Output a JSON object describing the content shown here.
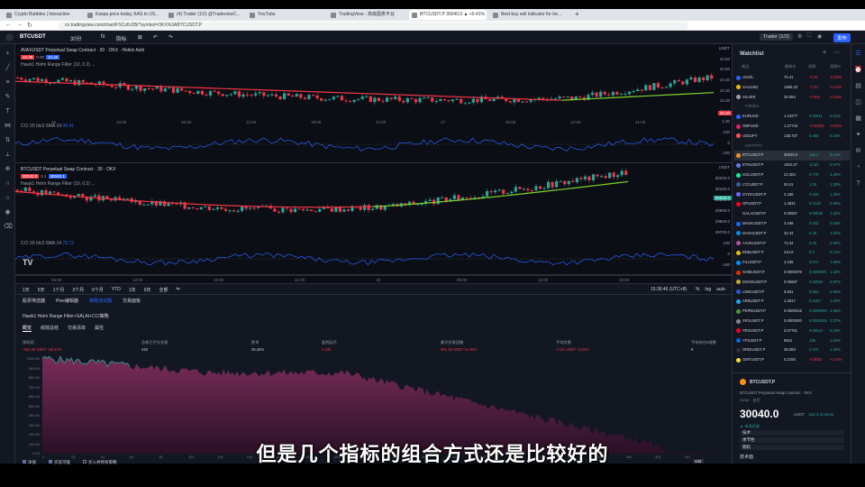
{
  "browser": {
    "tabs": [
      {
        "title": "Crypto Bubbles | Interactive",
        "active": false
      },
      {
        "title": "Kaspa price today, KAS to US...",
        "active": false
      },
      {
        "title": "(4) Trader (1/2) @TradeviewC...",
        "active": false
      },
      {
        "title": "YouTube",
        "active": false
      },
      {
        "title": "TradingView - 高级图表平台",
        "active": false
      },
      {
        "title": "BTCUSDT.P 30040.0 ▲ +0.41%",
        "active": true
      },
      {
        "title": "Best buy sell indicator for tre...",
        "active": false
      }
    ],
    "new_tab": "+",
    "url": "cn.tradingview.com/chart/FSCzfUZB/?symbol=OKX%3ABTCUSDT.P"
  },
  "toolbar": {
    "symbol": "BTCUSDT",
    "interval": "30分",
    "items": [
      "fx",
      "指标",
      "⊞",
      "↶",
      "↷"
    ],
    "right_items": [
      "Trader (1/2)",
      "⚙",
      "⛶",
      "📷"
    ],
    "publish": "发布"
  },
  "pane1": {
    "title": "AVAXUSDT Perpetual Swap Contract · 30 · OKX · Heikin Ashi",
    "bid": "10.39",
    "spread": "0.00",
    "ask": "10.40",
    "indicator": "Hawk1 Helm Range Filter (10, 0.2) ...",
    "rsi_label": "CCI 20 hlc3 SMA 14",
    "rsi_value": "45.41",
    "scale": [
      "USDT",
      "10.60",
      "10.50",
      "10.40",
      "10.30",
      "10.20",
      "10.10",
      "1.00",
      "100",
      "0",
      "-100"
    ],
    "time_labels": [
      "16",
      "10:00",
      "06:00",
      "12:00",
      "18:00",
      "21:00",
      "17",
      "06:00",
      "12:00",
      "21:00"
    ],
    "last_price": "10.40"
  },
  "pane2": {
    "title": "BTCUSDT Perpetual Swap Contract · 30 · OKX",
    "bid": "30040.0",
    "spread": "0.1",
    "ask": "30040.1",
    "indicator": "Hawk1 Helm Range Filter (10, 0.2) ...",
    "rsi_label": "CCI 20 hlc3 SMA 14",
    "rsi_value": "76.73",
    "scale": [
      "USDT",
      "30200.0",
      "30100.0",
      "30000.0",
      "29900.0",
      "29800.0",
      "29700.0",
      "100",
      "0",
      "-100"
    ],
    "time_labels": [
      "06:00",
      "12:00",
      "18:00",
      "21:00",
      "18",
      "06:00",
      "12:00",
      "15:00"
    ],
    "last_price": "30040.0",
    "logo": "TV"
  },
  "ranges": {
    "items": [
      "1天",
      "5天",
      "1个月",
      "3个月",
      "6个月",
      "YTD",
      "1年",
      "5年",
      "全部",
      "⇋"
    ],
    "clock": "15:36:46 (UTC+8)",
    "options": [
      "%",
      "log",
      "auto"
    ]
  },
  "bottom": {
    "tabs": [
      "股票筛选器",
      "Pine编辑器",
      "策略测试器",
      "交易面板"
    ],
    "strategy": "Hawk1 Helm Range Filter+SALAI+CCI策略",
    "subtabs": [
      "概览",
      "绩效总结",
      "交易清单",
      "属性"
    ],
    "stats": [
      {
        "label": "净利润",
        "value": "-981.39 USDT  -98.14%"
      },
      {
        "label": "总和已平仓交易",
        "value": "442"
      },
      {
        "label": "胜率",
        "value": "25.34%"
      },
      {
        "label": "盈利因子",
        "value": "0.432"
      },
      {
        "label": "最大交易回撤",
        "value": "981.39 USDT  11.48%"
      },
      {
        "label": "平均交易",
        "value": "-2.22 USDT  -0.22%"
      },
      {
        "label": "平均持仓K线数",
        "value": "9"
      }
    ],
    "y_labels": [
      "1000.00",
      "900.00",
      "800.00",
      "700.00",
      "600.00",
      "500.00",
      "400.00",
      "300.00",
      "200.00",
      "100.00",
      "0.00"
    ],
    "x_labels": [
      "1",
      "21",
      "41",
      "61",
      "81",
      "101",
      "121",
      "141",
      "161",
      "181",
      "201",
      "221",
      "241",
      "261",
      "281",
      "301",
      "321",
      "341",
      "361",
      "381",
      "401",
      "421",
      "441"
    ],
    "checkboxes": [
      "净值",
      "买卖可能",
      "买入并持有策略"
    ],
    "legend_value": "442"
  },
  "watchlist": {
    "title": "Watchlist",
    "columns": [
      "商品",
      "最新价",
      "涨跌",
      "涨跌%"
    ],
    "items": [
      {
        "sym": "USOIL",
        "last": "75.41",
        "chg": "-0.15",
        "pct": "-0.20%",
        "up": false,
        "color": "#2962ff"
      },
      {
        "sym": "XAUUSD",
        "last": "1965.33",
        "chg": "-2.70",
        "pct": "-0.14%",
        "up": false,
        "color": "#f0b90b"
      },
      {
        "sym": "SILVER",
        "last": "25.084",
        "chg": "-0.064",
        "pct": "-0.25%",
        "up": false,
        "color": "#9e9e9e"
      },
      {
        "sym": "FOREX",
        "section": true
      },
      {
        "sym": "EURUSD",
        "last": "1.10277",
        "chg": "0.00011",
        "pct": "0.01%",
        "up": true,
        "color": "#2962ff"
      },
      {
        "sym": "GBPUSD",
        "last": "1.27743",
        "chg": "-0.00054",
        "pct": "-0.04%",
        "up": false,
        "color": "#e91e63"
      },
      {
        "sym": "USDJPY",
        "last": "138.707",
        "chg": "0.466",
        "pct": "0.34%",
        "up": true,
        "color": "#ff5252"
      },
      {
        "sym": "CRYPTO",
        "section": true
      },
      {
        "sym": "BTCUSDT.P",
        "last": "30040.0",
        "chg": "122.4",
        "pct": "0.41%",
        "up": true,
        "color": "#f7931a",
        "active": true
      },
      {
        "sym": "ETHUSDT.P",
        "last": "1910.27",
        "chg": "12.83",
        "pct": "0.67%",
        "up": true,
        "color": "#627eea"
      },
      {
        "sym": "SOLUSDT.P",
        "last": "22.304",
        "chg": "0.779",
        "pct": "3.49%",
        "up": true,
        "color": "#14f195"
      },
      {
        "sym": "LTCUSDT.P",
        "last": "93.41",
        "chg": "1.29",
        "pct": "1.38%",
        "up": true,
        "color": "#345d9d"
      },
      {
        "sym": "DYDXUSDT.P",
        "last": "2.166",
        "chg": "0.030",
        "pct": "1.39%",
        "up": true,
        "color": "#6966ff"
      },
      {
        "sym": "OPUSDT.P",
        "last": "1.4931",
        "chg": "0.0148",
        "pct": "0.99%",
        "up": true,
        "color": "#ff0420"
      },
      {
        "sym": "GALAUSDT.P",
        "last": "0.02657",
        "chg": "0.00032",
        "pct": "1.22%",
        "up": true,
        "color": "#111111"
      },
      {
        "sym": "MASKUSDT.P",
        "last": "3.446",
        "chg": "0.032",
        "pct": "0.93%",
        "up": true,
        "color": "#1c68f3"
      },
      {
        "sym": "DASHUSDT.P",
        "last": "32.34",
        "chg": "0.49",
        "pct": "1.53%",
        "up": true,
        "color": "#008ce7"
      },
      {
        "sym": "AAVEUSDT.P",
        "last": "72.34",
        "chg": "0.43",
        "pct": "0.60%",
        "up": true,
        "color": "#b6509e"
      },
      {
        "sym": "BNBUSDT.P",
        "last": "244.8",
        "chg": "0.3",
        "pct": "0.12%",
        "up": true,
        "color": "#f0b90b"
      },
      {
        "sym": "FILUSDT.P",
        "last": "4.345",
        "chg": "0.071",
        "pct": "1.66%",
        "up": true,
        "color": "#0090ff"
      },
      {
        "sym": "SHIBUSDT.P",
        "last": "0.0000078",
        "chg": "0.0000001",
        "pct": "1.30%",
        "up": true,
        "color": "#e42d04"
      },
      {
        "sym": "DOGEUSDT.P",
        "last": "0.06697",
        "chg": "0.00058",
        "pct": "0.87%",
        "up": true,
        "color": "#c2a633"
      },
      {
        "sym": "LINKUSDT.P",
        "last": "5.931",
        "chg": "0.053",
        "pct": "0.90%",
        "up": true,
        "color": "#2a5ada"
      },
      {
        "sym": "ARBUSDT.P",
        "last": "1.2617",
        "chg": "0.0167",
        "pct": "1.34%",
        "up": true,
        "color": "#28a0f0"
      },
      {
        "sym": "PEPEUSDT.P",
        "last": "0.0000015",
        "chg": "0.0000000",
        "pct": "1.65%",
        "up": true,
        "color": "#4c9641"
      },
      {
        "sym": "XRXUSDT.P",
        "last": "0.0000000",
        "chg": "0.0000000",
        "pct": "0.37%",
        "up": true,
        "color": "#888888"
      },
      {
        "sym": "TRXUSDT.P",
        "last": "0.07761",
        "chg": "0.00012",
        "pct": "0.16%",
        "up": true,
        "color": "#ef0027"
      },
      {
        "sym": "YFIUSDT.P",
        "last": "6941",
        "chg": "105",
        "pct": "1.54%",
        "up": true,
        "color": "#006ae3"
      },
      {
        "sym": "ORDIUSDT.P",
        "last": "39.083",
        "chg": "0.472",
        "pct": "1.22%",
        "up": true,
        "color": "#333333"
      },
      {
        "sym": "GMTUSDT.P",
        "last": "0.2155",
        "chg": "-0.0003",
        "pct": "-0.14%",
        "up": false,
        "color": "#f7e03b"
      }
    ]
  },
  "detail": {
    "symbol": "BTCUSDT.P",
    "name": "BTCUSDT Perpetual Swap Contract · OKX",
    "exchange": "Swap · 加密",
    "price": "30040.0",
    "currency": "USDT",
    "change": "122.4 (0.41%)",
    "note": "▲ 市场开放",
    "tech": "技术面",
    "rows": [
      "技术",
      "季节性",
      "期权"
    ]
  },
  "subtitle": "但是几个指标的组合方式还是比较好的",
  "colors": {
    "up": "#26a69a",
    "down": "#f23645",
    "bg": "#131722",
    "accent": "#2962ff"
  }
}
